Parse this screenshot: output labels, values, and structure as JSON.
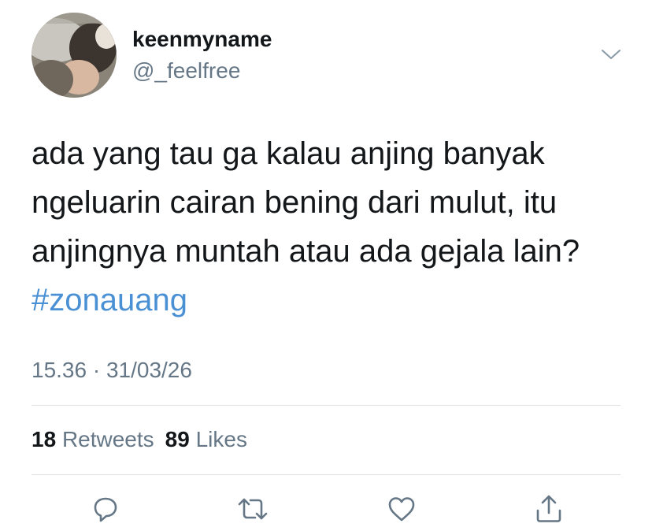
{
  "user": {
    "display_name": "keenmyname",
    "handle": "@_feelfree"
  },
  "tweet": {
    "lines": [
      "ada yang tau ga kalau anjing banyak",
      "ngeluarin cairan bening dari mulut, itu",
      "anjingnya muntah atau ada gejala lain?"
    ],
    "hashtag": "#zonauang",
    "timestamp": "15.36 · 31/03/26"
  },
  "stats": {
    "retweets_count": "18",
    "retweets_label": "Retweets",
    "likes_count": "89",
    "likes_label": "Likes"
  },
  "colors": {
    "hashtag": "#4a90d4",
    "secondary_text": "#657786",
    "primary_text": "#14171a",
    "divider": "#dfe3e6",
    "icon": "#657786"
  },
  "icons": {
    "menu": "chevron-down-icon",
    "reply": "reply-icon",
    "retweet": "retweet-icon",
    "like": "heart-icon",
    "share": "share-icon"
  }
}
